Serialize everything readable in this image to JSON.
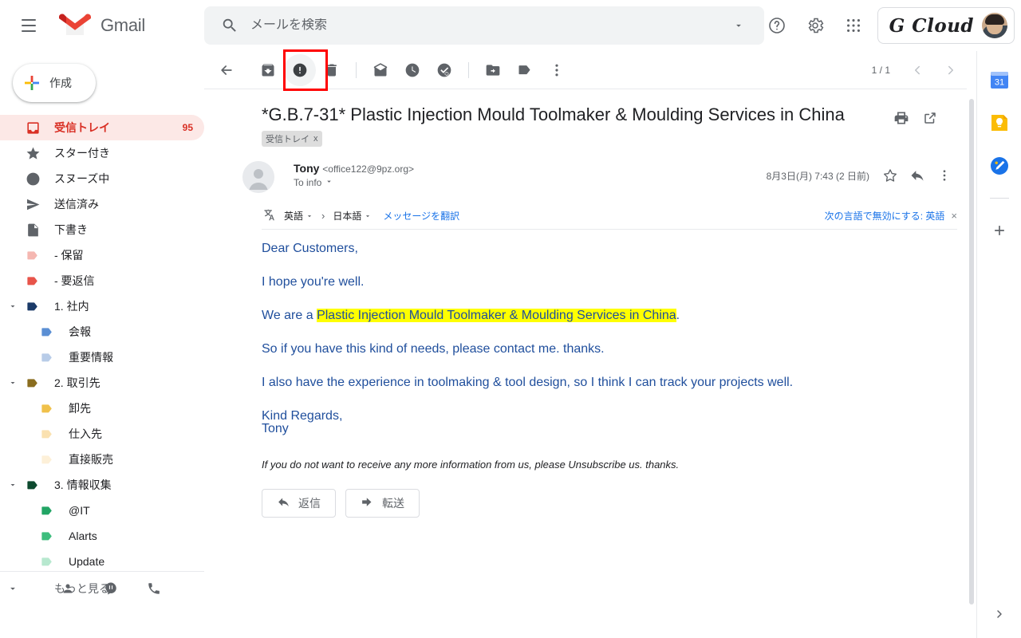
{
  "app": {
    "name": "Gmail"
  },
  "topbar": {
    "menu_icon": "hamburger-icon",
    "logo_text": "Gmail",
    "search": {
      "placeholder": "メールを検索",
      "value": "",
      "icon": "search-icon",
      "options_icon": "chevron-down-icon"
    },
    "help_icon": "help-icon",
    "settings_icon": "gear-icon",
    "apps_icon": "apps-grid-icon",
    "account": {
      "brand": "G Cloud",
      "avatar": "user-avatar"
    }
  },
  "sidebar": {
    "compose": {
      "label": "作成",
      "icon": "plus-icon"
    },
    "items": [
      {
        "label": "受信トレイ",
        "icon": "inbox-icon",
        "count": "95",
        "active": true,
        "level": 0,
        "caret": "",
        "color": "#d93025"
      },
      {
        "label": "スター付き",
        "icon": "star-icon",
        "count": "",
        "active": false,
        "level": 0,
        "caret": "",
        "color": "#5f6368"
      },
      {
        "label": "スヌーズ中",
        "icon": "clock-icon",
        "count": "",
        "active": false,
        "level": 0,
        "caret": "",
        "color": "#5f6368"
      },
      {
        "label": "送信済み",
        "icon": "send-icon",
        "count": "",
        "active": false,
        "level": 0,
        "caret": "",
        "color": "#5f6368"
      },
      {
        "label": "下書き",
        "icon": "draft-icon",
        "count": "",
        "active": false,
        "level": 0,
        "caret": "",
        "color": "#5f6368"
      },
      {
        "label": "- 保留",
        "icon": "label-icon",
        "count": "",
        "active": false,
        "level": 0,
        "caret": "",
        "color": "#f5b7b1"
      },
      {
        "label": "- 要返信",
        "icon": "label-icon",
        "count": "",
        "active": false,
        "level": 0,
        "caret": "",
        "color": "#e8544a"
      },
      {
        "label": "1. 社内",
        "icon": "label-icon",
        "count": "",
        "active": false,
        "level": 0,
        "caret": "down",
        "color": "#1b3a68"
      },
      {
        "label": "会報",
        "icon": "label-icon",
        "count": "",
        "active": false,
        "level": 1,
        "caret": "",
        "color": "#5b8fd4"
      },
      {
        "label": "重要情報",
        "icon": "label-icon",
        "count": "",
        "active": false,
        "level": 1,
        "caret": "",
        "color": "#b8cce8"
      },
      {
        "label": "2. 取引先",
        "icon": "label-icon",
        "count": "",
        "active": false,
        "level": 0,
        "caret": "down",
        "color": "#8a6d1f"
      },
      {
        "label": "卸先",
        "icon": "label-icon",
        "count": "",
        "active": false,
        "level": 1,
        "caret": "",
        "color": "#f0c14b"
      },
      {
        "label": "仕入先",
        "icon": "label-icon",
        "count": "",
        "active": false,
        "level": 1,
        "caret": "",
        "color": "#fae1b0"
      },
      {
        "label": "直接販売",
        "icon": "label-icon",
        "count": "",
        "active": false,
        "level": 1,
        "caret": "",
        "color": "#fdf0d8"
      },
      {
        "label": "3. 情報収集",
        "icon": "label-icon",
        "count": "",
        "active": false,
        "level": 0,
        "caret": "down",
        "color": "#0d4a2f"
      },
      {
        "label": "@IT",
        "icon": "label-icon",
        "count": "",
        "active": false,
        "level": 1,
        "caret": "",
        "color": "#22a565"
      },
      {
        "label": "Alarts",
        "icon": "label-icon",
        "count": "",
        "active": false,
        "level": 1,
        "caret": "",
        "color": "#3dbd7d"
      },
      {
        "label": "Update",
        "icon": "label-icon",
        "count": "",
        "active": false,
        "level": 1,
        "caret": "",
        "color": "#b7e8cf"
      }
    ],
    "more": {
      "label": "もっと見る",
      "icon": "chevron-down-icon"
    },
    "footer_icons": [
      "contacts-icon",
      "hangouts-chat-icon",
      "phone-icon"
    ]
  },
  "toolbar": {
    "back_icon": "arrow-left-icon",
    "archive_icon": "archive-icon",
    "report_spam_icon": "report-spam-icon",
    "delete_icon": "trash-icon",
    "mark_unread_icon": "mark-unread-icon",
    "snooze_icon": "clock-snooze-icon",
    "add_to_tasks_icon": "add-to-tasks-icon",
    "move_to_icon": "move-to-folder-icon",
    "labels_icon": "labels-icon",
    "more_icon": "more-vertical-icon",
    "pagination": "1 / 1",
    "prev_icon": "chevron-left-icon",
    "next_icon": "chevron-right-icon",
    "highlighted_button": "report-spam-icon"
  },
  "thread": {
    "subject": "*G.B.7-31* Plastic Injection Mould Toolmaker & Moulding Services in China",
    "label_chip": {
      "text": "受信トレイ",
      "remove": "x"
    },
    "print_icon": "print-icon",
    "popout_icon": "open-in-new-icon"
  },
  "message": {
    "sender_name": "Tony",
    "sender_email": "<office122@9pz.org>",
    "to_line": "To info",
    "to_caret_icon": "chevron-down-icon",
    "date": "8月3日(月) 7:43 (2 日前)",
    "star_icon": "star-outline-icon",
    "reply_icon": "reply-icon",
    "more_icon": "more-vertical-icon",
    "avatar_icon": "person-avatar-icon"
  },
  "translate_bar": {
    "icon": "translate-icon",
    "source_lang": "英語",
    "arrow": "›",
    "target_lang": "日本語",
    "translate_link": "メッセージを翻訳",
    "disable_link": "次の言語で無効にする: 英語",
    "close": "×",
    "caret_icon": "chevron-down-icon"
  },
  "body": {
    "greeting": "Dear Customers,",
    "line_hope": "I hope you're well.",
    "line_intro_prefix": "We are a ",
    "line_intro_highlight": "Plastic Injection Mould Toolmaker & Moulding Services in China",
    "line_intro_suffix": ".",
    "line_contact": "So if you have this kind of needs, please contact me. thanks.",
    "line_experience": "I also have the experience in toolmaking & tool design, so I think I can track your projects well.",
    "signoff": "Kind Regards,",
    "signature": "Tony",
    "unsubscribe": "If you do not want to receive any more information from us, please Unsubscribe us. thanks."
  },
  "actions": {
    "reply": {
      "label": "返信",
      "icon": "reply-icon"
    },
    "forward": {
      "label": "転送",
      "icon": "forward-icon"
    }
  },
  "right_panel": {
    "items": [
      {
        "name": "google-calendar-icon",
        "label": "31"
      },
      {
        "name": "google-keep-icon",
        "label": ""
      },
      {
        "name": "google-tasks-icon",
        "label": ""
      }
    ],
    "add": {
      "icon": "plus-icon"
    },
    "expand": {
      "icon": "chevron-right-icon"
    }
  },
  "colors": {
    "accent_red": "#d93025",
    "inbox_active_bg": "#fce8e6",
    "highlight_yellow": "#ffff00",
    "body_blue": "#1f4e9c",
    "link_blue": "#1a73e8",
    "red_box": "#ff0000"
  }
}
